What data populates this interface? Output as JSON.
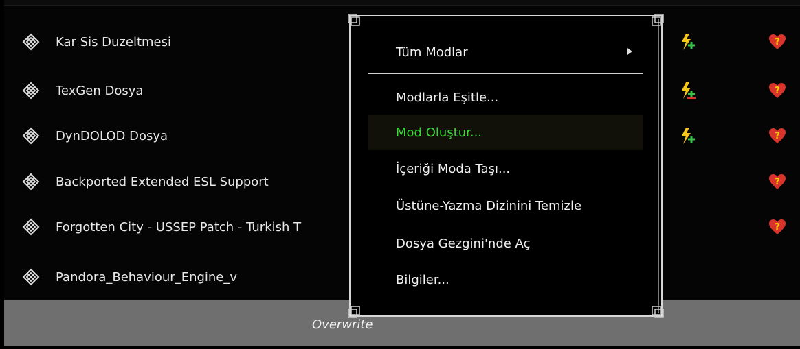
{
  "mod_list": {
    "rows": [
      {
        "name": "Kar Sis Duzeltmesi",
        "plugin_flag": "plugin-lightning-plus-icon",
        "warning": true
      },
      {
        "name": "TexGen Dosya",
        "plugin_flag": "plugin-lightning-plus-red-icon",
        "warning": true
      },
      {
        "name": "DynDOLOD Dosya",
        "plugin_flag": "plugin-lightning-plus-icon",
        "warning": true
      },
      {
        "name": "Backported Extended ESL Support",
        "plugin_flag": "",
        "warning": true
      },
      {
        "name": "Forgotten City - USSEP Patch - Turkish T",
        "plugin_flag": "",
        "warning": true
      },
      {
        "name": "Pandora_Behaviour_Engine_v",
        "plugin_flag": "",
        "warning": false
      }
    ]
  },
  "overwrite": {
    "label": "Overwrite"
  },
  "context_menu": {
    "items": [
      {
        "label": "Tüm Modlar",
        "has_submenu": true
      },
      {
        "label": "Modlarla Eşitle...",
        "has_submenu": false
      },
      {
        "label": "Mod Oluştur...",
        "has_submenu": false,
        "highlighted": true
      },
      {
        "label": "İçeriği Moda Taşı...",
        "has_submenu": false
      },
      {
        "label": "Üstüne-Yazma Dizinini Temizle",
        "has_submenu": false
      },
      {
        "label": "Dosya Gezgini'nde Aç",
        "has_submenu": false
      },
      {
        "label": "Bilgiler...",
        "has_submenu": false
      }
    ]
  },
  "colors": {
    "highlight_text": "#3ad93a",
    "plugin_yellow": "#f5c518",
    "plugin_green": "#39c24a",
    "warning_red": "#d9342b"
  }
}
